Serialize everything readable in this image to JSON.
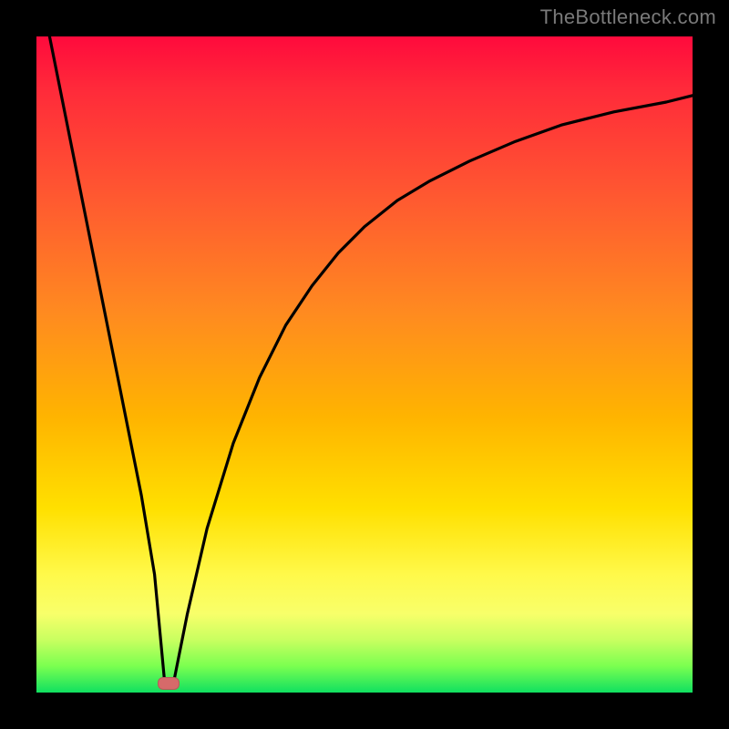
{
  "watermark": "TheBottleneck.com",
  "chart_data": {
    "type": "line",
    "title": "",
    "xlabel": "",
    "ylabel": "",
    "xlim": [
      0,
      100
    ],
    "ylim": [
      0,
      100
    ],
    "grid": false,
    "legend": false,
    "background": "gradient-red-to-green-vertical",
    "series": [
      {
        "name": "bottleneck-curve",
        "x": [
          2,
          4,
          6,
          8,
          10,
          12,
          14,
          16,
          18,
          19.5,
          21,
          23,
          26,
          30,
          34,
          38,
          42,
          46,
          50,
          55,
          60,
          66,
          73,
          80,
          88,
          96,
          100
        ],
        "y": [
          100,
          90,
          80,
          70,
          60,
          50,
          40,
          30,
          18,
          2,
          2,
          12,
          25,
          38,
          48,
          56,
          62,
          67,
          71,
          75,
          78,
          81,
          84,
          86.5,
          88.5,
          90,
          91
        ]
      }
    ],
    "minimum_marker": {
      "x": 20,
      "y": 1.5,
      "shape": "rounded-rect",
      "color": "#d66a6a"
    }
  },
  "colors": {
    "frame": "#000000",
    "curve": "#000000",
    "watermark": "#7a7a7a",
    "marker": "#d66a6a"
  }
}
